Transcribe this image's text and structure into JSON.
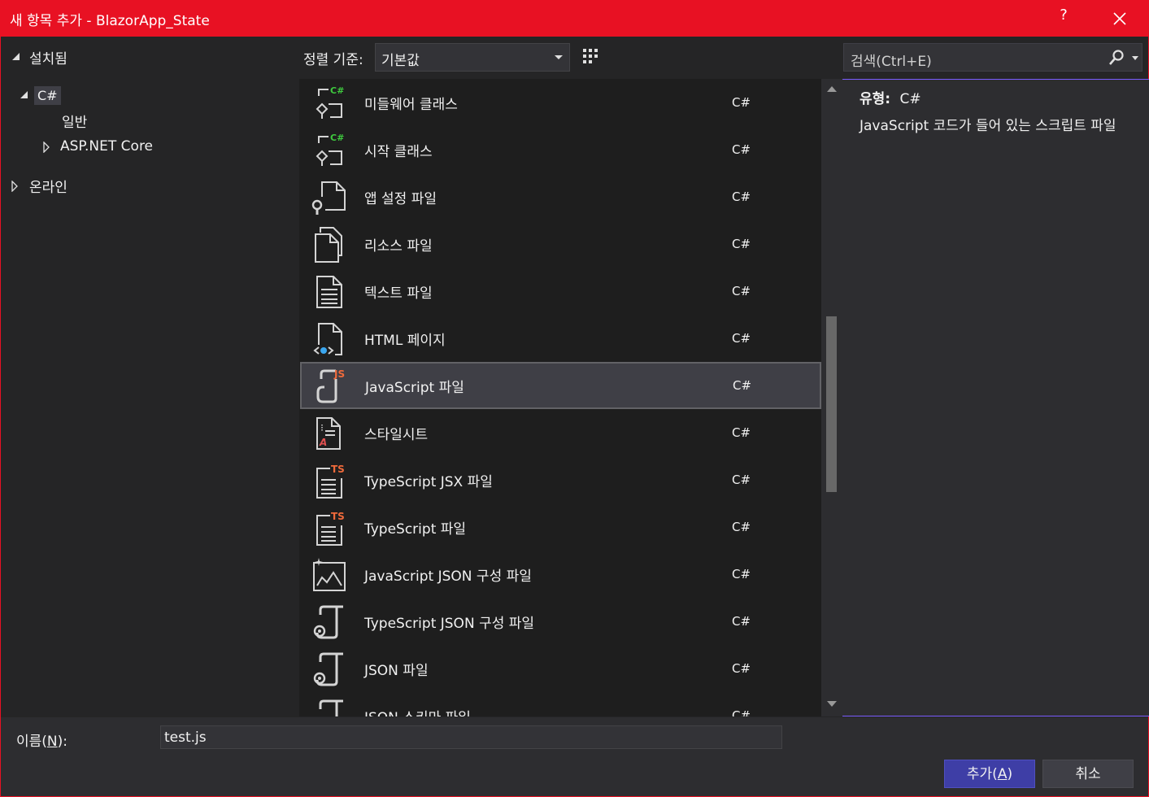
{
  "window": {
    "title": "새 항목 추가 - BlazorApp_State",
    "help_label": "?",
    "close_icon": "close-icon"
  },
  "tree": {
    "installed": "설치됨",
    "csharp": "C#",
    "general": "일반",
    "aspnet": "ASP.NET Core",
    "online": "온라인"
  },
  "sort": {
    "label": "정렬 기준:",
    "value": "기본값"
  },
  "search": {
    "placeholder": "검색(Ctrl+E)"
  },
  "items": [
    {
      "name": "미들웨어 클래스",
      "lang": "C#",
      "icon": "middleware-class-icon"
    },
    {
      "name": "시작 클래스",
      "lang": "C#",
      "icon": "startup-class-icon"
    },
    {
      "name": "앱 설정 파일",
      "lang": "C#",
      "icon": "app-settings-icon"
    },
    {
      "name": "리소스 파일",
      "lang": "C#",
      "icon": "resource-file-icon"
    },
    {
      "name": "텍스트 파일",
      "lang": "C#",
      "icon": "text-file-icon"
    },
    {
      "name": "HTML 페이지",
      "lang": "C#",
      "icon": "html-page-icon"
    },
    {
      "name": "JavaScript 파일",
      "lang": "C#",
      "icon": "javascript-file-icon",
      "selected": true
    },
    {
      "name": "스타일시트",
      "lang": "C#",
      "icon": "stylesheet-icon"
    },
    {
      "name": "TypeScript JSX 파일",
      "lang": "C#",
      "icon": "typescript-jsx-icon"
    },
    {
      "name": "TypeScript 파일",
      "lang": "C#",
      "icon": "typescript-file-icon"
    },
    {
      "name": "JavaScript JSON 구성 파일",
      "lang": "C#",
      "icon": "js-json-config-icon"
    },
    {
      "name": "TypeScript JSON 구성 파일",
      "lang": "C#",
      "icon": "ts-json-config-icon"
    },
    {
      "name": "JSON 파일",
      "lang": "C#",
      "icon": "json-file-icon"
    },
    {
      "name": "JSON 스키마 파일",
      "lang": "C#",
      "icon": "json-schema-icon"
    }
  ],
  "details": {
    "type_label": "유형:",
    "type_value": "C#",
    "description": "JavaScript 코드가 들어 있는 스크립트 파일"
  },
  "footer": {
    "name_label_pre": "이름(",
    "name_label_key": "N",
    "name_label_post": "):",
    "name_value": "test.js",
    "add_pre": "추가(",
    "add_key": "A",
    "add_post": ")",
    "cancel_label": "취소"
  },
  "colors": {
    "accent": "#e81123",
    "add_button": "#3e3ea6",
    "selected_row": "#3f3f46"
  }
}
